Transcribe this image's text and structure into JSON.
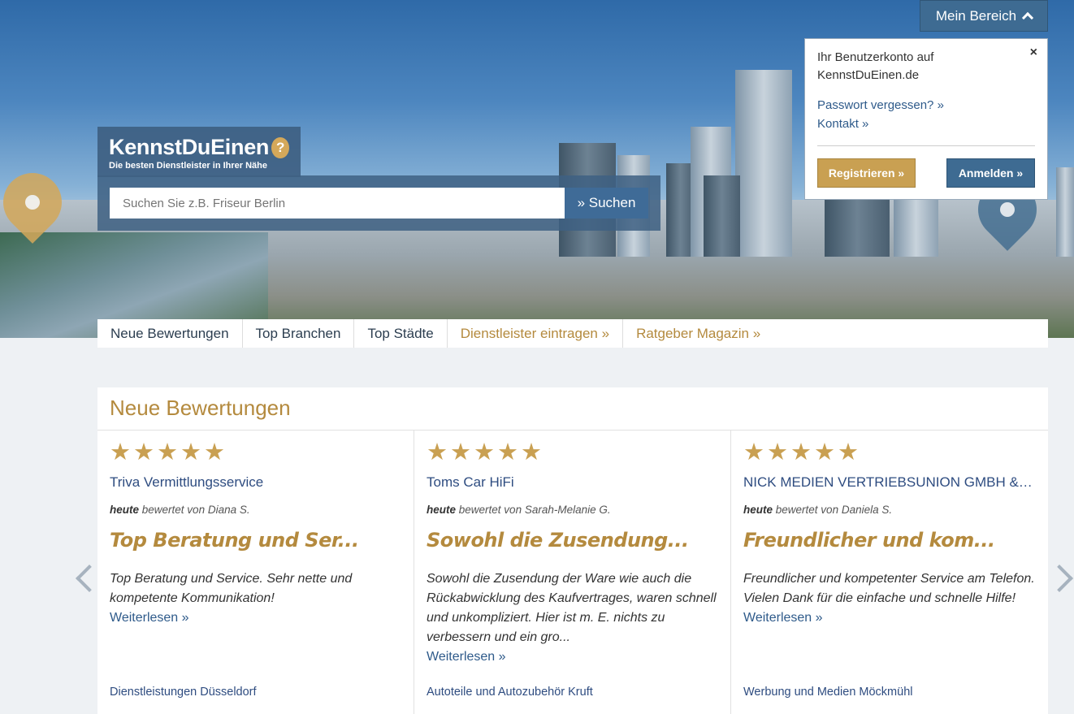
{
  "header": {
    "logo_text": "KennstDuEinen",
    "logo_tagline": "Die besten Dienstleister in Ihrer Nähe",
    "search_placeholder": "Suchen Sie z.B. Friseur Berlin",
    "search_button": "» Suchen"
  },
  "account": {
    "menu_label": "Mein Bereich",
    "panel_title": "Ihr Benutzerkonto auf KennstDuEinen.de",
    "close_symbol": "×",
    "links": [
      "Passwort vergessen? »",
      "Kontakt »"
    ],
    "register_button": "Registrieren »",
    "login_button": "Anmelden »"
  },
  "nav": {
    "items": [
      "Neue Bewertungen",
      "Top Branchen",
      "Top Städte",
      "Dienstleister eintragen »",
      "Ratgeber Magazin »"
    ]
  },
  "reviews": {
    "section_title": "Neue Bewertungen",
    "date_label": "heute",
    "rated_by_prefix": "bewertet von",
    "read_more": "Weiterlesen »",
    "star_color": "#c9a052",
    "items": [
      {
        "stars": 5,
        "company": "Triva Vermittlungsservice",
        "reviewer": "Diana S.",
        "headline": "Top Beratung und Ser...",
        "text": "Top Beratung und Service. Sehr nette und kompetente Kommunikation!",
        "category": "Dienstleistungen Düsseldorf"
      },
      {
        "stars": 5,
        "company": "Toms Car HiFi",
        "reviewer": "Sarah-Melanie G.",
        "headline": "Sowohl die Zusendung...",
        "text": "Sowohl die Zusendung der Ware wie auch die Rückabwicklung des Kaufvertrages, waren schnell und unkompliziert. Hier ist m. E. nichts zu verbessern und ein gro...",
        "category": "Autoteile und Autozubehör Kruft"
      },
      {
        "stars": 5,
        "company": "NICK MEDIEN VERTRIEBSUNION GMBH & CO....",
        "reviewer": "Daniela S.",
        "headline": "Freundlicher und kom...",
        "text": "Freundlicher und kompetenter Service am Telefon. Vielen Dank für die einfache und schnelle Hilfe!",
        "category": "Werbung und Medien Möckmühl"
      }
    ]
  },
  "colors": {
    "brand_blue": "#3e6b92",
    "brand_gold": "#c9a052"
  }
}
